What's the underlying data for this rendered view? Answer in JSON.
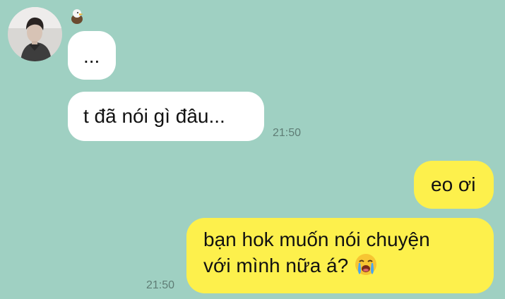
{
  "conversation": {
    "contact": {
      "avatar_icon": "contact-avatar-photo",
      "badge_icon": "eagle-sticker-icon"
    },
    "messages": [
      {
        "direction": "received",
        "text": "..."
      },
      {
        "direction": "received",
        "text": "t đã nói gì đâu...",
        "time": "21:50"
      },
      {
        "direction": "sent",
        "text": "eo ơi"
      },
      {
        "direction": "sent",
        "line1": "bạn hok muốn nói chuyện",
        "line2": "với mình nữa á?",
        "emoji_icon": "loudly-crying-face-icon",
        "time": "21:50"
      }
    ]
  },
  "colors": {
    "background": "#9fd0c2",
    "received_bubble": "#ffffff",
    "sent_bubble": "#fdf04c",
    "timestamp": "#5f7d75"
  }
}
